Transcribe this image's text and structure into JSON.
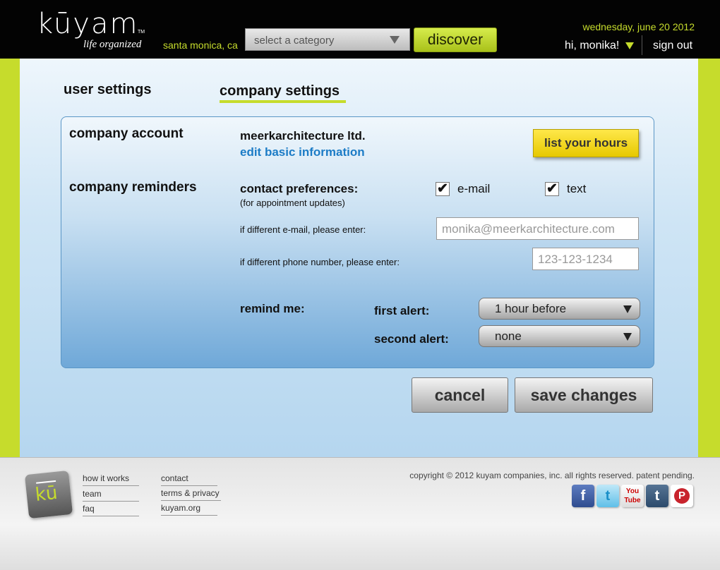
{
  "header": {
    "logo_text": "kūyam",
    "logo_tm": "TM",
    "tagline": "life organized",
    "location": "santa monica, ca",
    "category_placeholder": "select a category",
    "discover_label": "discover",
    "date": "wednesday, june 20 2012",
    "greeting": "hi, monika!",
    "signout_label": "sign out"
  },
  "tabs": {
    "user_settings": "user settings",
    "company_settings": "company settings"
  },
  "company_account": {
    "heading": "company account",
    "company_name": "meerkarchitecture ltd.",
    "edit_link": "edit basic information",
    "list_hours_button": "list your hours"
  },
  "reminders": {
    "heading": "company reminders",
    "contact_pref_label": "contact preferences:",
    "contact_pref_sub": "(for appointment updates)",
    "email_checkbox": {
      "label": "e-mail",
      "checked": true
    },
    "text_checkbox": {
      "label": "text",
      "checked": true
    },
    "email_prompt": "if different e-mail, please enter:",
    "email_placeholder": "monika@meerkarchitecture.com",
    "phone_prompt": "if different phone number, please enter:",
    "phone_placeholder": "123-123-1234",
    "remind_label": "remind me:",
    "first_alert_label": "first alert:",
    "first_alert_value": "1 hour before",
    "second_alert_label": "second alert:",
    "second_alert_value": "none"
  },
  "actions": {
    "cancel": "cancel",
    "save": "save changes"
  },
  "footer": {
    "links_col1": [
      "how it works",
      "team",
      "faq"
    ],
    "links_col2": [
      "contact",
      "terms & privacy",
      "kuyam.org"
    ],
    "copyright": "copyright © 2012 kuyam companies, inc. all rights reserved. patent pending.",
    "logo_text": "kū",
    "social": [
      "facebook",
      "twitter",
      "youtube",
      "tumblr",
      "pinterest"
    ]
  },
  "colors": {
    "accent_green": "#c6dc2c",
    "header_bg": "#030303",
    "link_blue": "#1c7cc6",
    "hours_yellow": "#ffe84a"
  }
}
